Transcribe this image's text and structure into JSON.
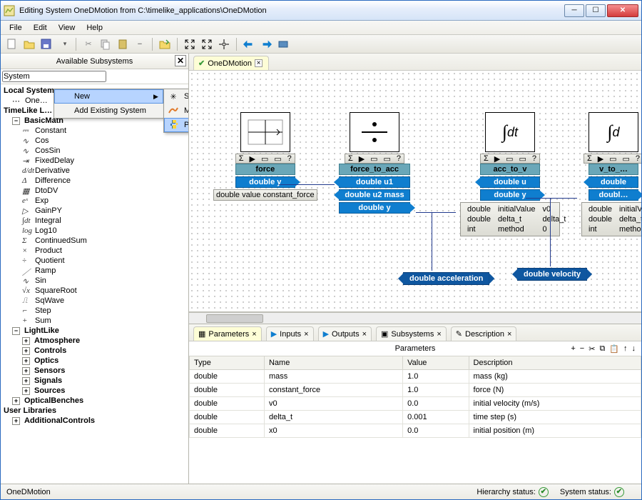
{
  "window": {
    "title": "Editing System OneDMotion from C:\\timelike_applications\\OneDMotion"
  },
  "menubar": [
    "File",
    "Edit",
    "View",
    "Help"
  ],
  "left_panel": {
    "header": "Available Subsystems",
    "selector_value": "System",
    "groups": {
      "local": {
        "label": "Local Systems",
        "items": [
          "One…"
        ]
      },
      "timelike": {
        "label": "TimeLike L…",
        "basicmath_label": "BasicMath",
        "basicmath": [
          "Constant",
          "Cos",
          "CosSin",
          "FixedDelay",
          "Derivative",
          "Difference",
          "DtoDV",
          "Exp",
          "GainPY",
          "Integral",
          "Log10",
          "ContinuedSum",
          "Product",
          "Quotient",
          "Ramp",
          "Sin",
          "SquareRoot",
          "SqWave",
          "Step",
          "Sum"
        ],
        "lightlike_label": "LightLike",
        "lightlike": [
          "Atmosphere",
          "Controls",
          "Optics",
          "Sensors",
          "Signals",
          "Sources"
        ],
        "optical": "OpticalBenches"
      },
      "user": {
        "label": "User Libraries",
        "item": "AdditionalControls"
      }
    }
  },
  "context_menu": {
    "new": "New",
    "add_existing": "Add Existing System",
    "sub_system": "System",
    "sub_matlab": "Matlab System",
    "sub_python": "Python System"
  },
  "canvas": {
    "tab_label": "OneDMotion",
    "blocks": {
      "force": {
        "name": "force",
        "port_out": "double y",
        "param": "double value constant_force"
      },
      "f2a": {
        "name": "force_to_acc",
        "in1": "double u1",
        "in2": "double u2 mass",
        "out": "double y"
      },
      "a2v": {
        "name": "acc_to_v",
        "in": "double u",
        "out": "double y",
        "params": [
          [
            "double",
            "initialValue",
            "v0"
          ],
          [
            "double",
            "delta_t",
            "delta_t"
          ],
          [
            "int",
            "method",
            "0"
          ]
        ]
      },
      "v2x": {
        "name": "v_to_…",
        "in": "double",
        "out": "doubl…",
        "params": [
          [
            "double",
            "initialV…",
            ""
          ],
          [
            "double",
            "delta_t",
            ""
          ],
          [
            "int",
            "method",
            ""
          ]
        ]
      }
    },
    "float_tags": {
      "acc": "double acceleration",
      "vel": "double velocity"
    }
  },
  "bottom": {
    "tabs": [
      "Parameters",
      "Inputs",
      "Outputs",
      "Subsystems",
      "Description"
    ],
    "title": "Parameters",
    "columns": [
      "Type",
      "Name",
      "Value",
      "Description"
    ],
    "rows": [
      {
        "type": "double",
        "name": "mass",
        "value": "1.0",
        "desc": "mass (kg)"
      },
      {
        "type": "double",
        "name": "constant_force",
        "value": "1.0",
        "desc": "force (N)"
      },
      {
        "type": "double",
        "name": "v0",
        "value": "0.0",
        "desc": "initial velocity (m/s)"
      },
      {
        "type": "double",
        "name": "delta_t",
        "value": "0.001",
        "desc": "time step (s)"
      },
      {
        "type": "double",
        "name": "x0",
        "value": "0.0",
        "desc": "initial position (m)"
      }
    ]
  },
  "statusbar": {
    "left": "OneDMotion",
    "hierarchy": "Hierarchy status:",
    "system": "System status:"
  }
}
